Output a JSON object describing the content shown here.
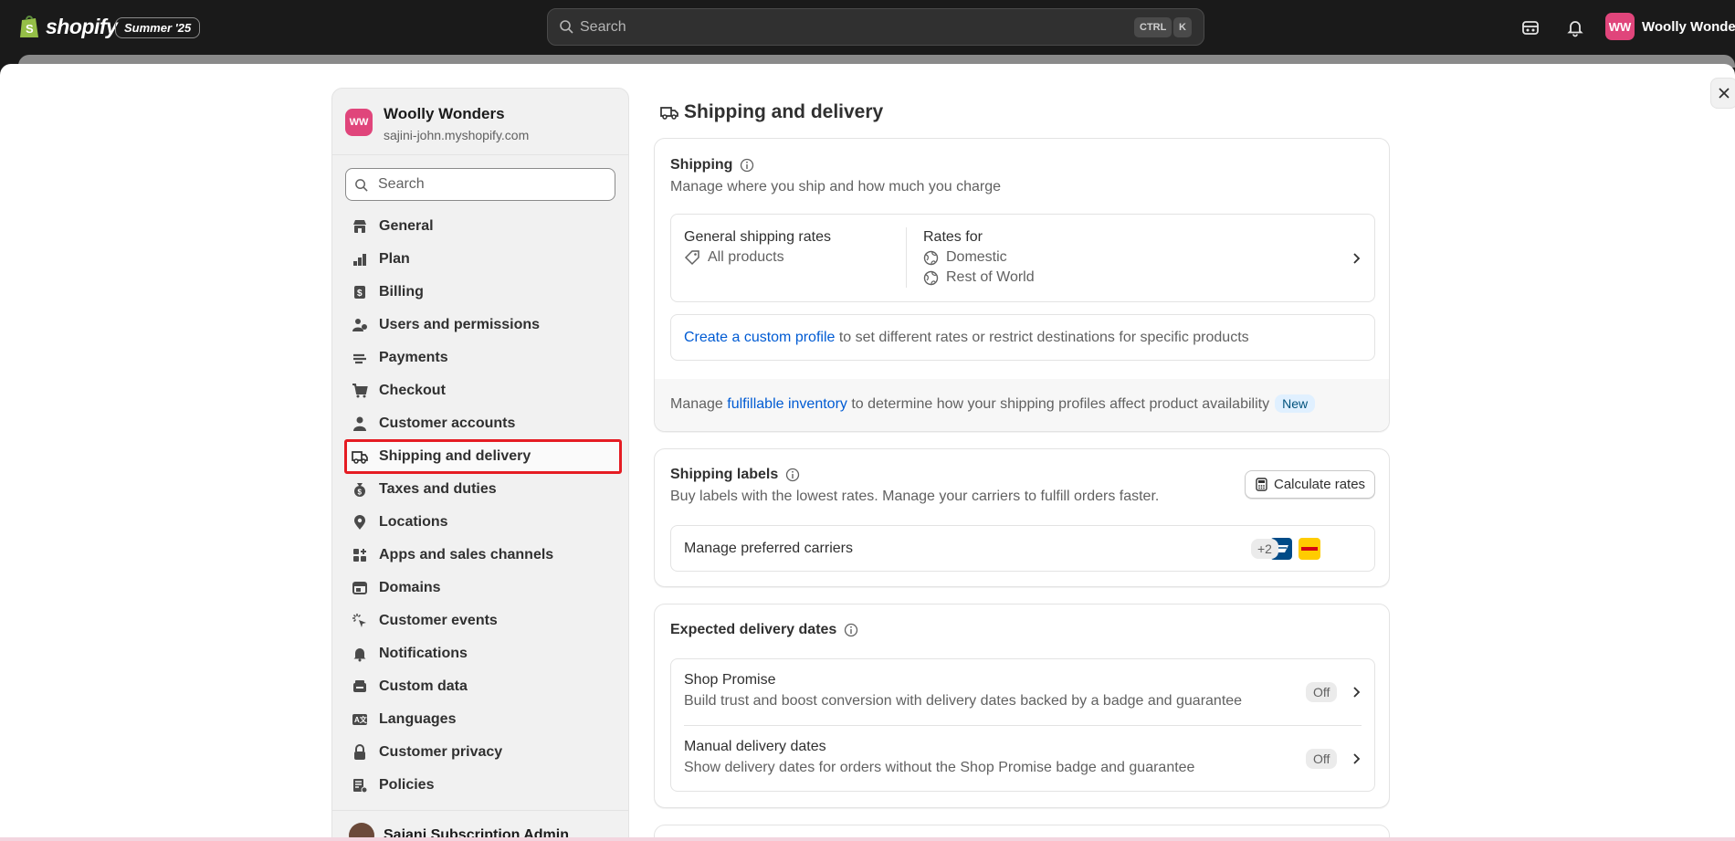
{
  "topbar": {
    "logo_text": "shopify",
    "edition": "Summer '25",
    "search_placeholder": "Search",
    "kbd_ctrl": "CTRL",
    "kbd_k": "K",
    "user_initials": "WW",
    "user_name": "Woolly Wonders"
  },
  "sidebar": {
    "store_initials": "WW",
    "store_name": "Woolly Wonders",
    "store_url": "sajini-john.myshopify.com",
    "search_placeholder": "Search",
    "items": [
      {
        "label": "General",
        "icon": "store-icon"
      },
      {
        "label": "Plan",
        "icon": "plan-icon"
      },
      {
        "label": "Billing",
        "icon": "billing-icon"
      },
      {
        "label": "Users and permissions",
        "icon": "users-icon"
      },
      {
        "label": "Payments",
        "icon": "payments-icon"
      },
      {
        "label": "Checkout",
        "icon": "cart-icon"
      },
      {
        "label": "Customer accounts",
        "icon": "person-icon"
      },
      {
        "label": "Shipping and delivery",
        "icon": "truck-icon",
        "active": true
      },
      {
        "label": "Taxes and duties",
        "icon": "money-bag-icon"
      },
      {
        "label": "Locations",
        "icon": "location-pin-icon"
      },
      {
        "label": "Apps and sales channels",
        "icon": "apps-icon"
      },
      {
        "label": "Domains",
        "icon": "globe-window-icon"
      },
      {
        "label": "Customer events",
        "icon": "cursor-click-icon"
      },
      {
        "label": "Notifications",
        "icon": "bell-icon"
      },
      {
        "label": "Custom data",
        "icon": "database-icon"
      },
      {
        "label": "Languages",
        "icon": "translate-icon"
      },
      {
        "label": "Customer privacy",
        "icon": "lock-icon"
      },
      {
        "label": "Policies",
        "icon": "policy-icon"
      }
    ],
    "sub_admin": "Sajani Subscription Admin"
  },
  "page": {
    "title": "Shipping and delivery",
    "shipping": {
      "title": "Shipping",
      "subtitle": "Manage where you ship and how much you charge",
      "general_rates": "General shipping rates",
      "all_products": "All products",
      "rates_for": "Rates for",
      "domestic": "Domestic",
      "rest_of_world": "Rest of World",
      "custom_profile_link": "Create a custom profile",
      "custom_profile_rest": " to set different rates or restrict destinations for specific products",
      "manage_prefix": "Manage ",
      "fulfillable_link": "fulfillable inventory",
      "manage_rest": " to determine how your shipping profiles affect product availability",
      "new_badge": "New"
    },
    "labels": {
      "title": "Shipping labels",
      "subtitle": "Buy labels with the lowest rates. Manage your carriers to fulfill orders faster.",
      "calc_button": "Calculate rates",
      "carriers_label": "Manage preferred carriers",
      "more_carriers": "+2"
    },
    "delivery": {
      "title": "Expected delivery dates",
      "shop_promise_title": "Shop Promise",
      "shop_promise_desc": "Build trust and boost conversion with delivery dates backed by a badge and guarantee",
      "shop_promise_status": "Off",
      "manual_title": "Manual delivery dates",
      "manual_desc": "Show delivery dates for orders without the Shop Promise badge and guarantee",
      "manual_status": "Off"
    }
  }
}
